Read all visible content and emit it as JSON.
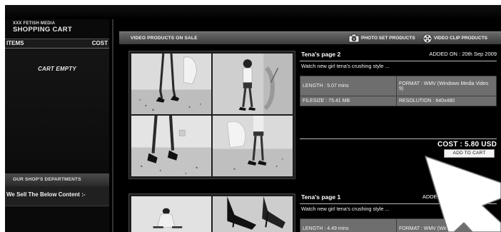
{
  "left_panel": {
    "header_small": "XXX FETISH MEDIA",
    "header_big": "SHOPPING CART",
    "col_items": "ITEMS",
    "col_cost": "COST",
    "cart_empty": "CART EMPTY",
    "departments_title": "OUR SHOP'S DEPARTMENTS",
    "departments_text": "We Sell The Below Content :-"
  },
  "section": {
    "title": "VIDEO PRODUCTS ON SALE",
    "nav_photo": "PHOTO SET PRODUCTS",
    "nav_video": "VIDEO CLIP PRODUCTS"
  },
  "products": [
    {
      "title": "Tena's page 2",
      "added": "ADDED ON : 20th Sep 2009",
      "description": "Watch new girl tena's crushing style ...",
      "length": "LENGTH : 5.07 mins",
      "format": "FORMAT : WMV (Windows Media Video 9)",
      "filesize": "FILESIZE : 75.41 MB",
      "resolution": "RESOLUTION : 640x480",
      "cost": "COST : 5.80 USD",
      "add_to_cart": "ADD TO CART"
    },
    {
      "title": "Tena's page 1",
      "added": "ADDED O",
      "description": "Watch new girl tena's crushing style ...",
      "length": "LENGTH : 4.49 mins",
      "format": "FORMAT : WMV (Windo"
    }
  ],
  "icons": {
    "photo": "camera-icon",
    "video": "film-reel-icon",
    "overlay": "arrow-cursor-icon"
  }
}
